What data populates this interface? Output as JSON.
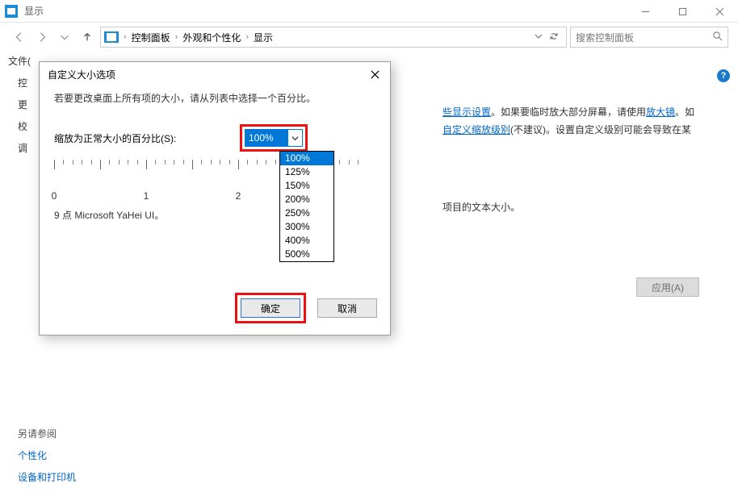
{
  "window": {
    "title": "显示",
    "min_btn": "minimize",
    "max_btn": "maximize",
    "close_btn": "close"
  },
  "nav": {
    "back": "back",
    "forward": "forward",
    "recent_dropdown": "recent",
    "up": "up",
    "refresh": "refresh"
  },
  "breadcrumbs": {
    "root": "控制面板",
    "cat": "外观和个性化",
    "page": "显示",
    "sep": "›"
  },
  "search": {
    "placeholder": "搜索控制面板"
  },
  "menu": {
    "file": "文件("
  },
  "help_icon": "?",
  "sidebar": {
    "i0": "控",
    "i1": "更",
    "i2": "校",
    "i3": "调"
  },
  "main": {
    "line1_pre": "",
    "link1": "些显示设置",
    "line1_post": "。如果要临时放大部分屏幕，请使用",
    "link_magnifier": "放大镜",
    "line1_tail": "。如",
    "link_custom": "自定义缩放级别",
    "line2_post": "(不建议)。设置自定义级别可能会导致在某",
    "line3": "项目的文本大小。",
    "apply": "应用(A)"
  },
  "footer": {
    "header": "另请参阅",
    "link1": "个性化",
    "link2": "设备和打印机"
  },
  "dialog": {
    "title": "自定义大小选项",
    "close": "close",
    "instruction": "若要更改桌面上所有项的大小，请从列表中选择一个百分比。",
    "scale_label": "缩放为正常大小的百分比(S):",
    "selected_value": "100%",
    "options": {
      "o0": "100%",
      "o1": "125%",
      "o2": "150%",
      "o3": "200%",
      "o4": "250%",
      "o5": "300%",
      "o6": "400%",
      "o7": "500%"
    },
    "ruler": {
      "l0": "0",
      "l1": "1",
      "l2": "2"
    },
    "sample": "9 点 Microsoft YaHei UI。",
    "ok": "确定",
    "cancel": "取消"
  }
}
